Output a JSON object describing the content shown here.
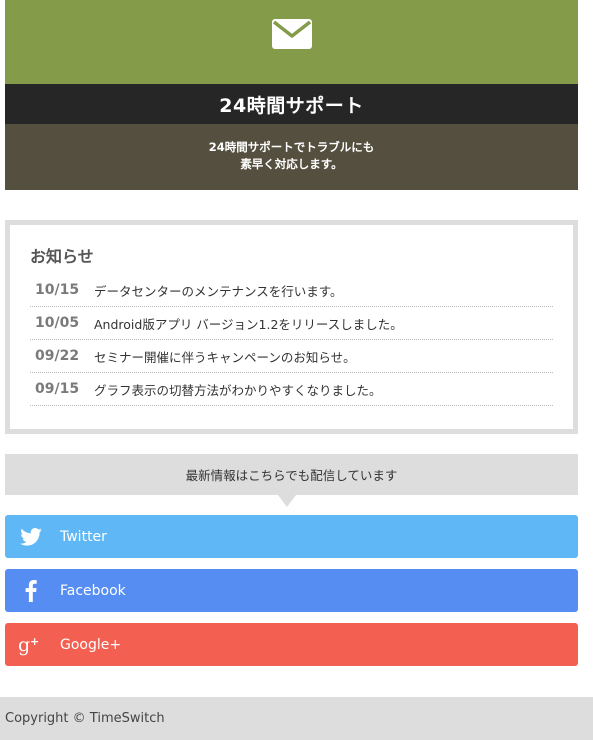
{
  "support": {
    "icon": "envelope-icon",
    "title": "24時間サポート",
    "desc_line1": "24時間サポートでトラブルにも",
    "desc_line2": "素早く対応します。",
    "colors": {
      "hero": "#849b49",
      "titlebar": "#262626",
      "desc": "#544f3f"
    }
  },
  "news": {
    "heading": "お知らせ",
    "items": [
      {
        "date": "10/15",
        "text": "データセンターのメンテナンスを行います。"
      },
      {
        "date": "10/05",
        "text": "Android版アプリ バージョン1.2をリリースしました。"
      },
      {
        "date": "09/22",
        "text": "セミナー開催に伴うキャンペーンのお知らせ。"
      },
      {
        "date": "09/15",
        "text": "グラフ表示の切替方法がわかりやすくなりました。"
      }
    ]
  },
  "sns": {
    "banner": "最新情報はこちらでも配信しています",
    "buttons": [
      {
        "label": "Twitter",
        "icon": "twitter-bird-icon",
        "color": "#5fb8f5"
      },
      {
        "label": "Facebook",
        "icon": "facebook-f-icon",
        "color": "#568df3"
      },
      {
        "label": "Google+",
        "icon": "google-plus-icon",
        "color": "#f35f51"
      }
    ]
  },
  "footer": {
    "copyright": "Copyright © TimeSwitch"
  }
}
